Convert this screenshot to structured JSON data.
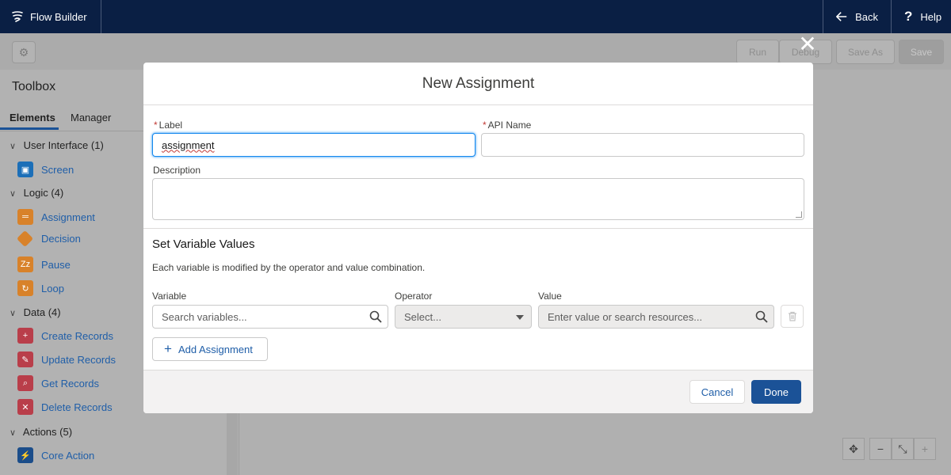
{
  "topbar": {
    "app_title": "Flow Builder",
    "back_label": "Back",
    "help_label": "Help"
  },
  "toolbar": {
    "run_label": "Run",
    "debug_label": "Debug",
    "save_as_label": "Save As",
    "save_label": "Save"
  },
  "toolbox": {
    "title": "Toolbox",
    "tabs": [
      "Elements",
      "Manager"
    ],
    "sections": [
      {
        "label": "User Interface (1)",
        "items": [
          {
            "label": "Screen",
            "icon": "screen-icon"
          }
        ]
      },
      {
        "label": "Logic (4)",
        "items": [
          {
            "label": "Assignment",
            "icon": "assignment-icon"
          },
          {
            "label": "Decision",
            "icon": "decision-icon"
          },
          {
            "label": "Pause",
            "icon": "pause-icon"
          },
          {
            "label": "Loop",
            "icon": "loop-icon"
          }
        ]
      },
      {
        "label": "Data (4)",
        "items": [
          {
            "label": "Create Records",
            "icon": "create-records-icon"
          },
          {
            "label": "Update Records",
            "icon": "update-records-icon"
          },
          {
            "label": "Get Records",
            "icon": "get-records-icon"
          },
          {
            "label": "Delete Records",
            "icon": "delete-records-icon"
          }
        ]
      },
      {
        "label": "Actions (5)",
        "items": [
          {
            "label": "Core Action",
            "icon": "core-action-icon"
          }
        ]
      }
    ]
  },
  "modal": {
    "title": "New Assignment",
    "label_field": {
      "label": "Label",
      "value": "assignment"
    },
    "api_name_field": {
      "label": "API Name",
      "value": ""
    },
    "description_field": {
      "label": "Description",
      "value": ""
    },
    "section_title": "Set Variable Values",
    "section_desc": "Each variable is modified by the operator and value combination.",
    "variable": {
      "label": "Variable",
      "placeholder": "Search variables..."
    },
    "operator": {
      "label": "Operator",
      "selected": "Select..."
    },
    "value": {
      "label": "Value",
      "placeholder": "Enter value or search resources..."
    },
    "add_assignment_label": "Add Assignment",
    "cancel_label": "Cancel",
    "done_label": "Done",
    "required_mark": "*"
  },
  "colors": {
    "topbar": "#0a1f44",
    "brand_blue": "#1b5297",
    "focus_blue": "#1589ee",
    "required_red": "#c23934"
  }
}
